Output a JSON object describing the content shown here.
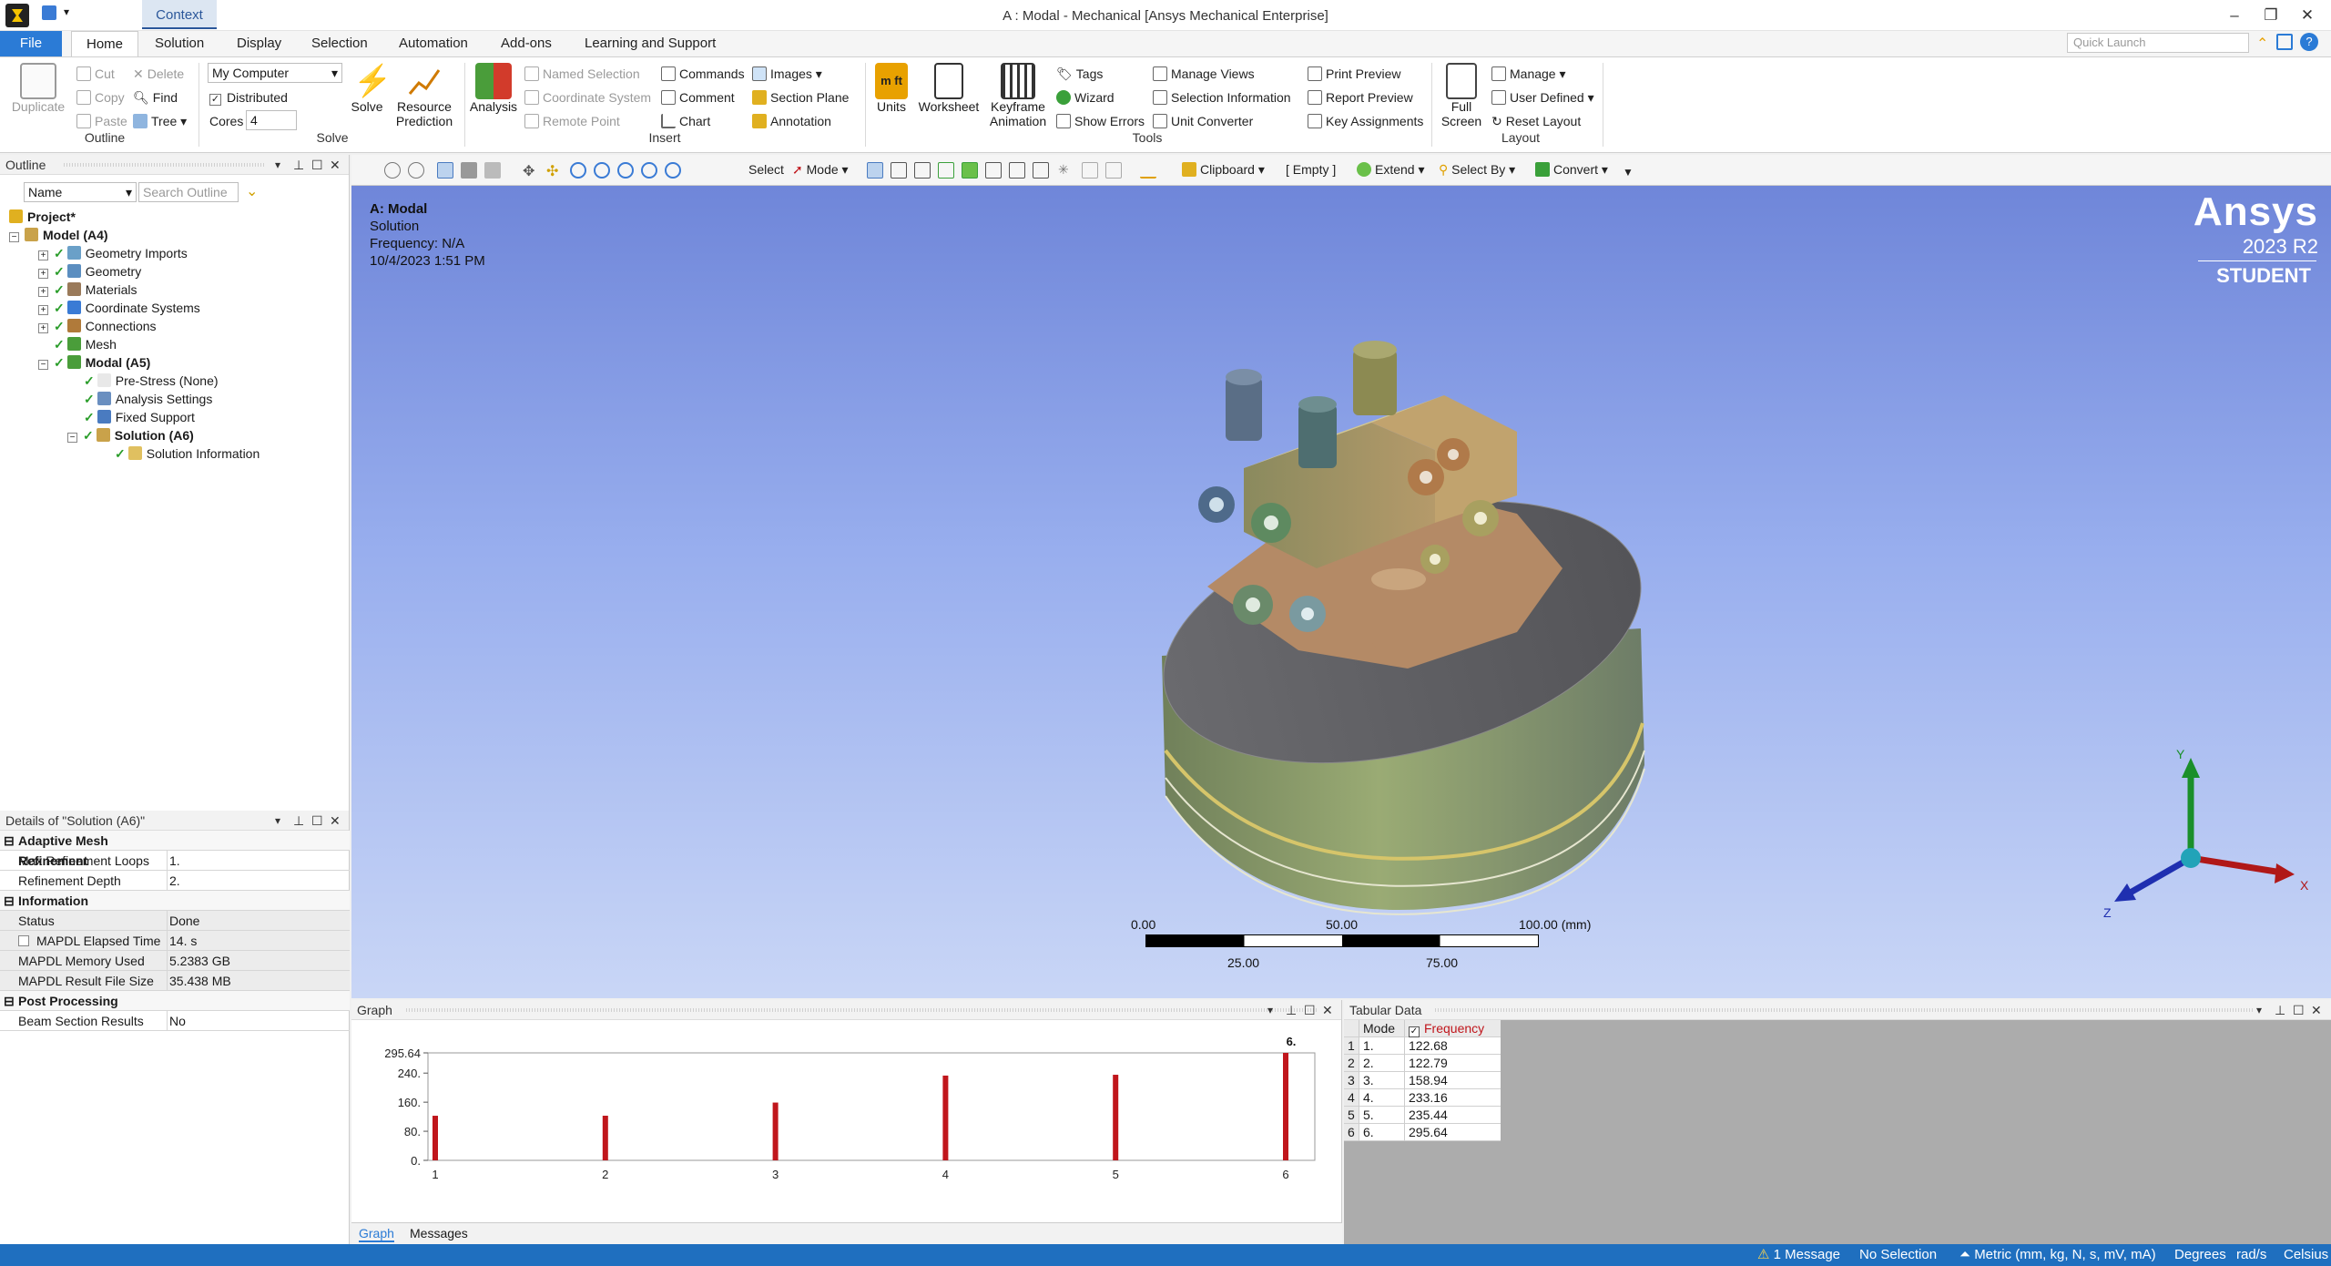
{
  "titlebar": {
    "context_tab": "Context",
    "title": "A : Modal - Mechanical [Ansys Mechanical Enterprise]",
    "quick_launch_placeholder": "Quick Launch"
  },
  "ribbon_tabs": [
    "File",
    "Home",
    "Solution",
    "Display",
    "Selection",
    "Automation",
    "Add-ons",
    "Learning and Support"
  ],
  "ribbon": {
    "outline_group": {
      "label": "Outline",
      "duplicate": "Duplicate",
      "cut": "Cut",
      "copy": "Copy",
      "paste": "Paste",
      "delete": "Delete",
      "find": "Find",
      "tree": "Tree"
    },
    "solve_group": {
      "label": "Solve",
      "computer": "My Computer",
      "distributed": "Distributed",
      "cores_label": "Cores",
      "cores_value": "4",
      "solve": "Solve",
      "resource": "Resource",
      "prediction": "Prediction"
    },
    "insert_group": {
      "label": "Insert",
      "analysis": "Analysis",
      "named_selection": "Named Selection",
      "coordinate_system": "Coordinate System",
      "remote_point": "Remote Point",
      "commands": "Commands",
      "comment": "Comment",
      "chart": "Chart",
      "images": "Images",
      "section_plane": "Section Plane",
      "annotation": "Annotation"
    },
    "tools_group": {
      "label": "Tools",
      "units": "Units",
      "worksheet": "Worksheet",
      "keyframe": "Keyframe",
      "animation": "Animation",
      "tags": "Tags",
      "wizard": "Wizard",
      "show_errors": "Show Errors",
      "manage_views": "Manage Views",
      "selection_information": "Selection Information",
      "unit_converter": "Unit Converter",
      "print_preview": "Print Preview",
      "report_preview": "Report Preview",
      "key_assignments": "Key Assignments"
    },
    "layout_group": {
      "label": "Layout",
      "full": "Full",
      "screen": "Screen",
      "manage": "Manage",
      "user_defined": "User Defined",
      "reset_layout": "Reset Layout"
    }
  },
  "outline": {
    "title": "Outline",
    "name_filter": "Name",
    "search_placeholder": "Search Outline",
    "tree": [
      {
        "label": "Project*",
        "bold": true
      },
      {
        "label": "Model (A4)",
        "bold": true
      },
      {
        "label": "Geometry Imports"
      },
      {
        "label": "Geometry"
      },
      {
        "label": "Materials"
      },
      {
        "label": "Coordinate Systems"
      },
      {
        "label": "Connections"
      },
      {
        "label": "Mesh"
      },
      {
        "label": "Modal (A5)",
        "bold": true
      },
      {
        "label": "Pre-Stress (None)"
      },
      {
        "label": "Analysis Settings"
      },
      {
        "label": "Fixed Support"
      },
      {
        "label": "Solution (A6)",
        "bold": true
      },
      {
        "label": "Solution Information"
      }
    ]
  },
  "details": {
    "title": "Details of \"Solution (A6)\"",
    "sections": [
      {
        "name": "Adaptive Mesh Refinement",
        "rows": [
          [
            "Max Refinement Loops",
            "1."
          ],
          [
            "Refinement Depth",
            "2."
          ]
        ]
      },
      {
        "name": "Information",
        "rows": [
          [
            "Status",
            "Done"
          ],
          [
            "MAPDL Elapsed Time",
            "14. s"
          ],
          [
            "MAPDL Memory Used",
            "5.2383 GB"
          ],
          [
            "MAPDL Result File Size",
            "35.438 MB"
          ]
        ]
      },
      {
        "name": "Post Processing",
        "rows": [
          [
            "Beam Section Results",
            "No"
          ]
        ]
      }
    ]
  },
  "graphics_toolbar": {
    "select": "Select",
    "mode": "Mode",
    "clipboard": "Clipboard",
    "empty": "[ Empty ]",
    "extend": "Extend",
    "select_by": "Select By",
    "convert": "Convert"
  },
  "viewport": {
    "heading": "A: Modal",
    "line2": "Solution",
    "line3": "Frequency: N/A",
    "line4": "10/4/2023 1:51 PM",
    "brand": "Ansys",
    "version": "2023 R2",
    "edition": "STUDENT",
    "scale_labels_top": [
      "0.00",
      "50.00",
      "100.00 (mm)"
    ],
    "scale_labels_bottom": [
      "25.00",
      "75.00"
    ],
    "axes": {
      "x": "X",
      "y": "Y",
      "z": "Z"
    }
  },
  "graph_panel": {
    "title": "Graph",
    "tabs": [
      "Graph",
      "Messages"
    ],
    "peak_label": "6."
  },
  "chart_data": {
    "type": "bar",
    "categories": [
      "1",
      "2",
      "3",
      "4",
      "5",
      "6"
    ],
    "values": [
      122.68,
      122.79,
      158.94,
      233.16,
      235.44,
      295.64
    ],
    "yticks": [
      "295.64",
      "240.",
      "160.",
      "80.",
      "0."
    ],
    "ylim": [
      0,
      295.64
    ],
    "color": "#c0161c"
  },
  "tabular": {
    "title": "Tabular Data",
    "headers": [
      "Mode",
      "Frequency [Hz]"
    ],
    "rows": [
      [
        "1",
        "1.",
        "122.68"
      ],
      [
        "2",
        "2.",
        "122.79"
      ],
      [
        "3",
        "3.",
        "158.94"
      ],
      [
        "4",
        "4.",
        "233.16"
      ],
      [
        "5",
        "5.",
        "235.44"
      ],
      [
        "6",
        "6.",
        "295.64"
      ]
    ]
  },
  "statusbar": {
    "messages": "1 Message",
    "selection": "No Selection",
    "units": "Metric (mm, kg, N, s, mV, mA)",
    "degrees": "Degrees",
    "rads": "rad/s",
    "temp": "Celsius"
  }
}
